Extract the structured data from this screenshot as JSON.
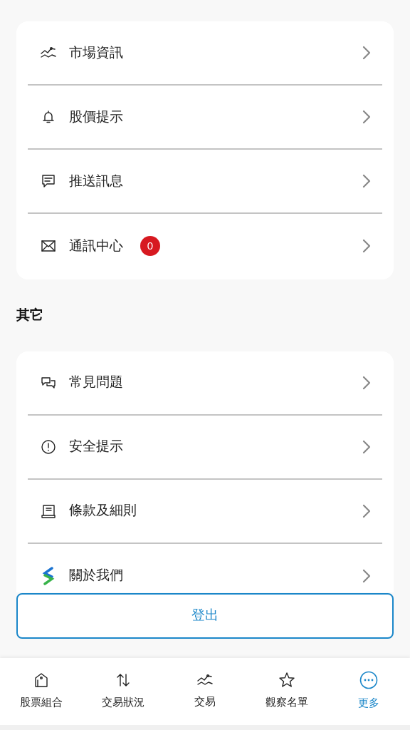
{
  "sections": [
    {
      "items": [
        {
          "kind": "chart",
          "label": "市場資訊"
        },
        {
          "kind": "bell",
          "label": "股價提示"
        },
        {
          "kind": "message",
          "label": "推送訊息"
        },
        {
          "kind": "mail",
          "label": "通訊中心",
          "badge": "0"
        }
      ]
    },
    {
      "title": "其它",
      "items": [
        {
          "kind": "chat",
          "label": "常見問題"
        },
        {
          "kind": "alert",
          "label": "安全提示"
        },
        {
          "kind": "document",
          "label": "條款及細則"
        },
        {
          "kind": "logo",
          "label": "關於我們"
        }
      ]
    }
  ],
  "logout": "登出",
  "nav": [
    {
      "kind": "tag",
      "label": "股票組合",
      "selected": false
    },
    {
      "kind": "arrows",
      "label": "交易狀況",
      "selected": false
    },
    {
      "kind": "chart",
      "label": "交易",
      "selected": false
    },
    {
      "kind": "star",
      "label": "觀察名單",
      "selected": false
    },
    {
      "kind": "more",
      "label": "更多",
      "selected": true
    }
  ]
}
